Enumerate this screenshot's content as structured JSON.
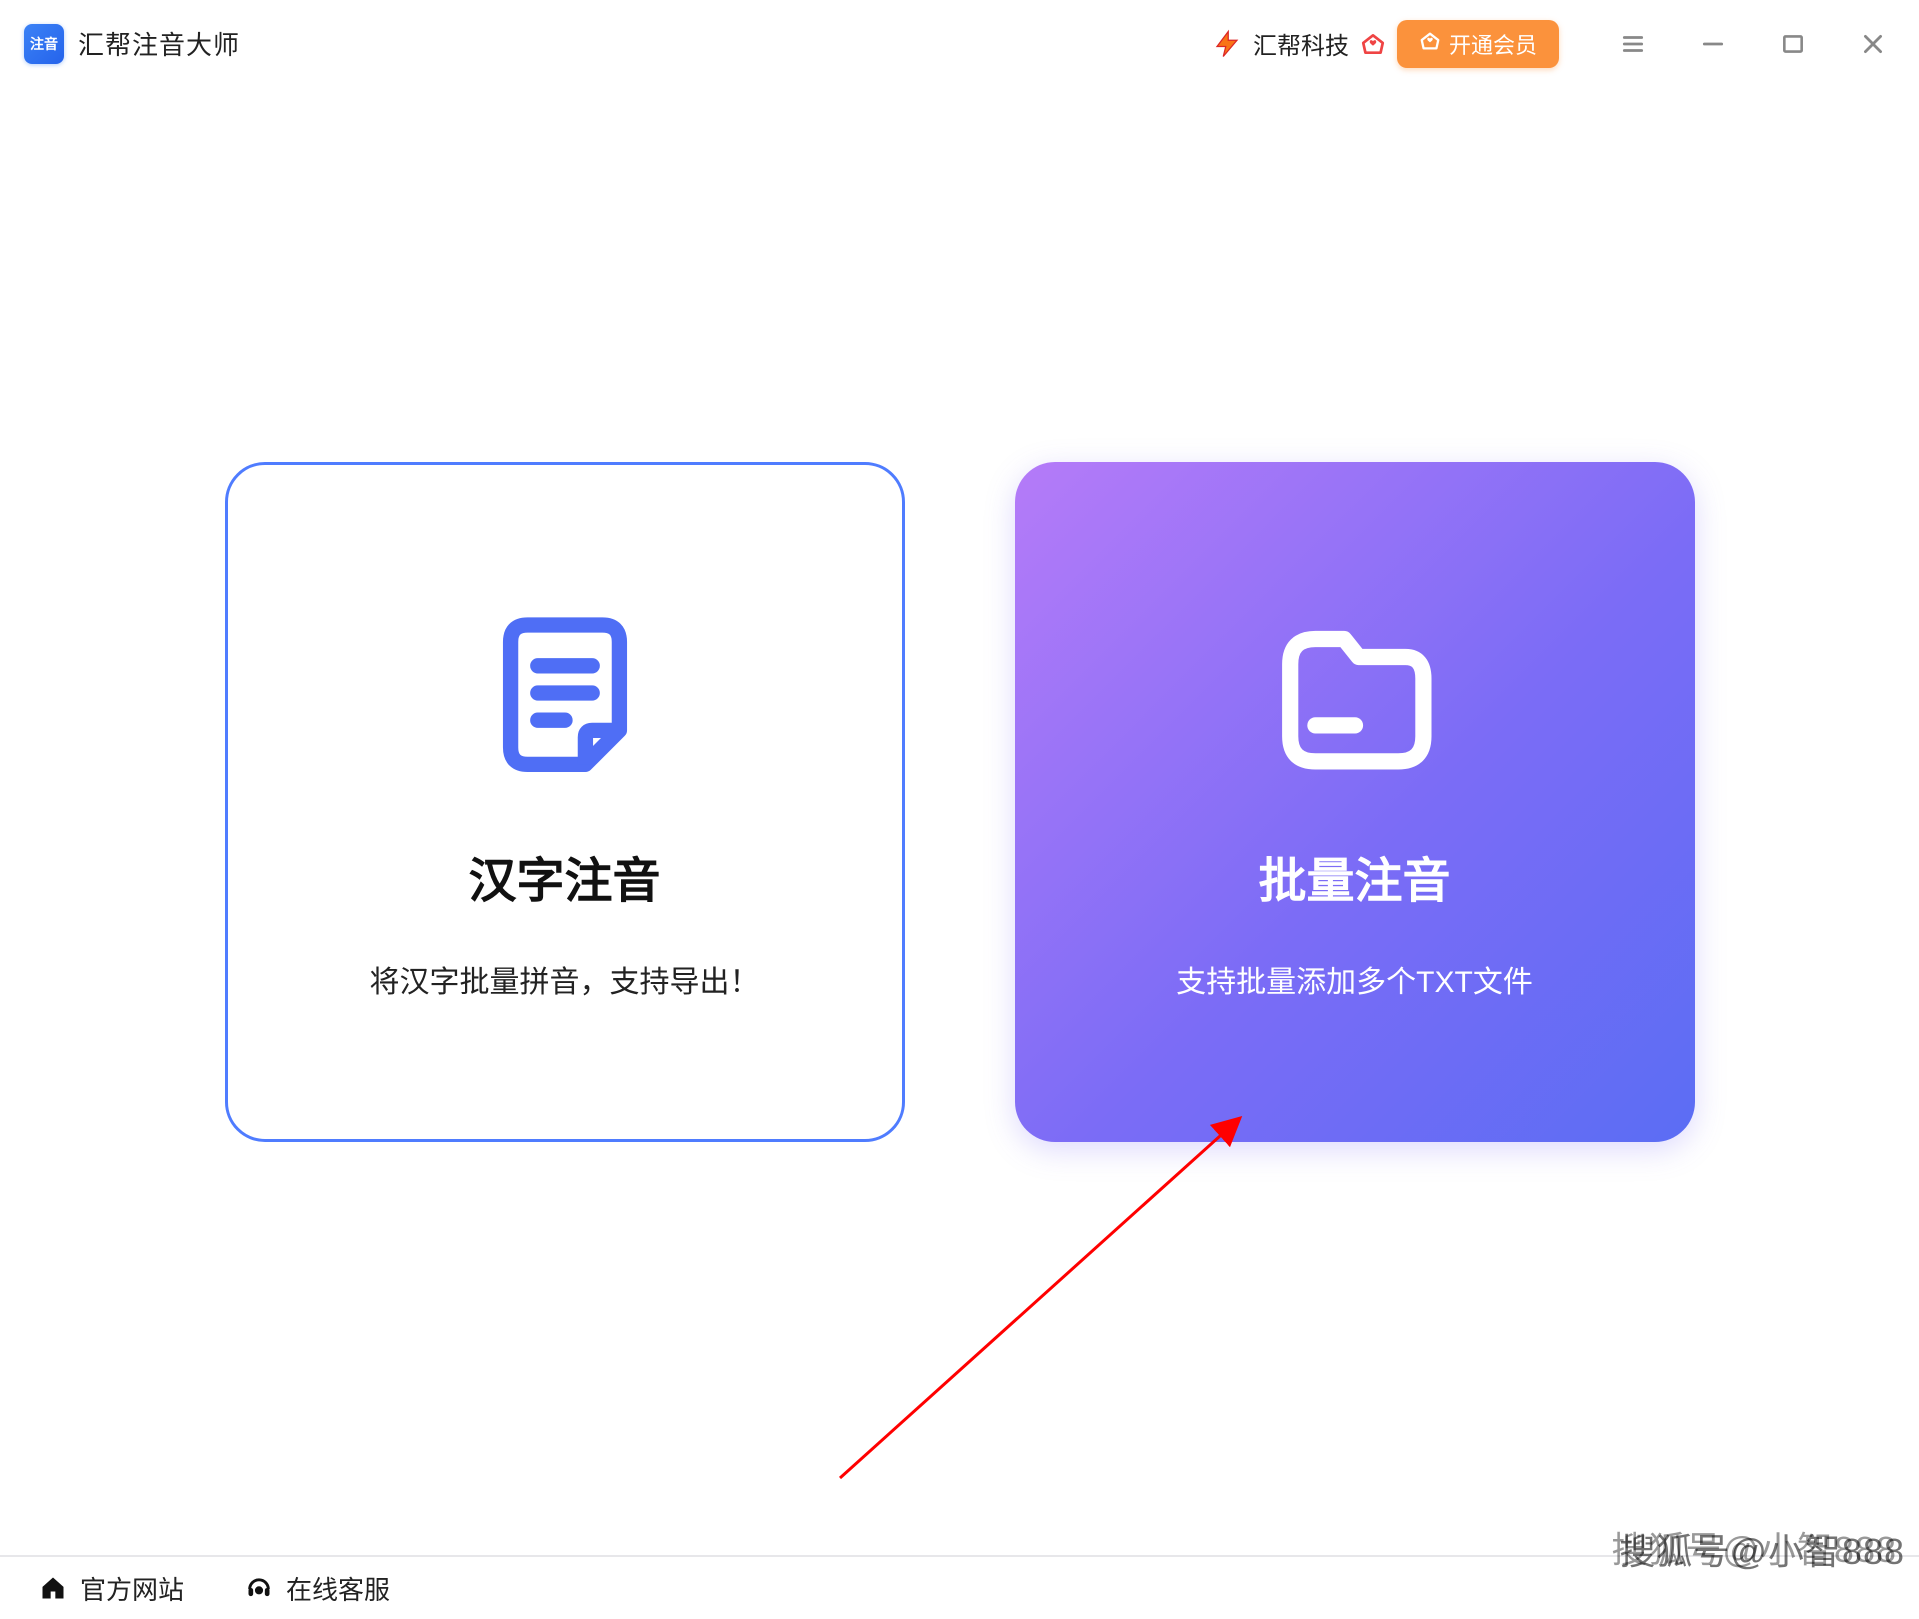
{
  "titlebar": {
    "app_title": "汇帮注音大师",
    "app_logo_text": "注音",
    "brand": "汇帮科技",
    "vip_label": "开通会员"
  },
  "cards": {
    "hanzi": {
      "title": "汉字注音",
      "desc": "将汉字批量拼音，支持导出！"
    },
    "batch": {
      "title": "批量注音",
      "desc": "支持批量添加多个TXT文件"
    }
  },
  "footer": {
    "website": "官方网站",
    "support": "在线客服"
  },
  "watermark": "搜狐号@小智888"
}
